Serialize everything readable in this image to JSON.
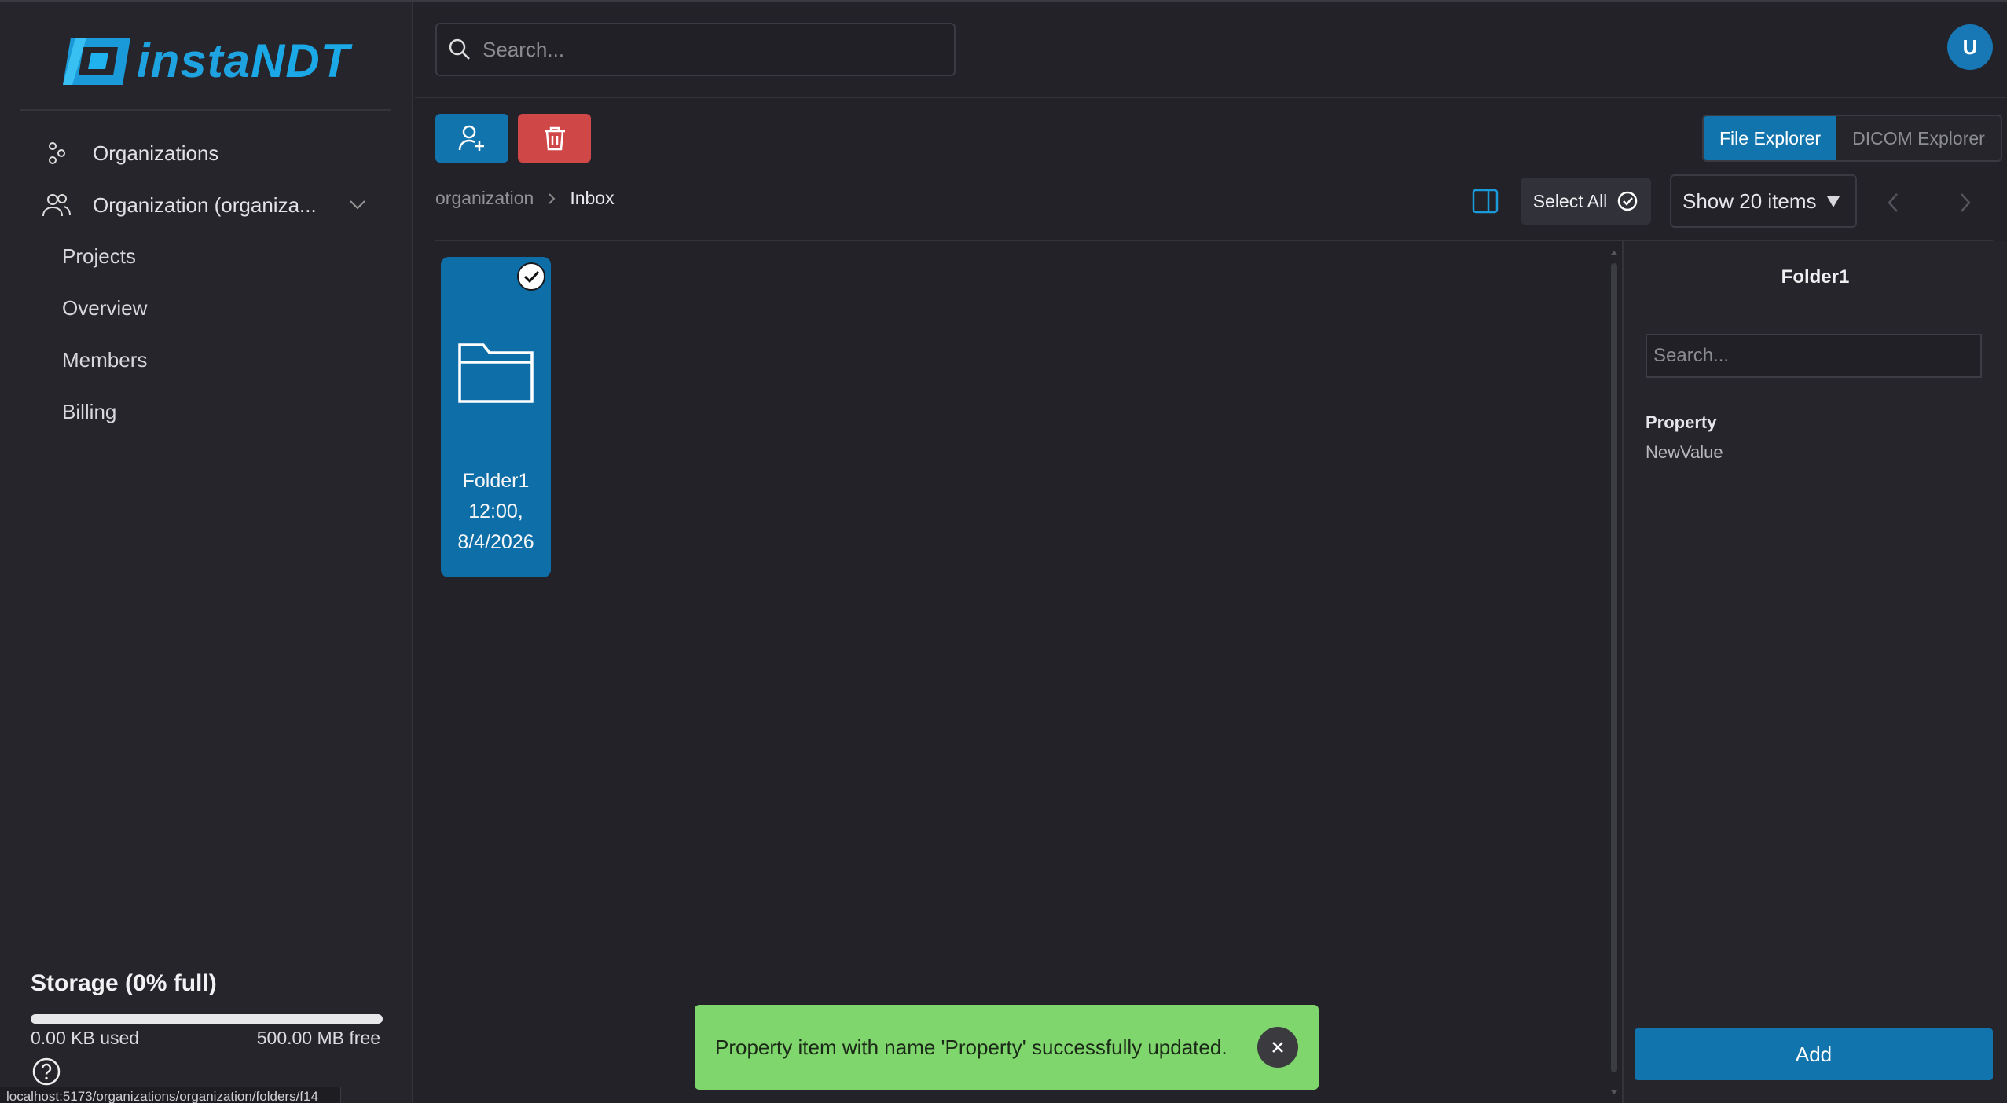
{
  "app": {
    "logo_text_a": "insta",
    "logo_text_b": "NDT",
    "brand_color": "#1ba8e6"
  },
  "sidebar": {
    "items": [
      {
        "label": "Organizations",
        "icon": "nodes-icon"
      },
      {
        "label": "Organization (organiza...",
        "icon": "users-icon"
      }
    ],
    "subitems": [
      {
        "label": "Projects"
      },
      {
        "label": "Overview"
      },
      {
        "label": "Members"
      },
      {
        "label": "Billing"
      }
    ],
    "storage": {
      "title": "Storage (0% full)",
      "used": "0.00 KB used",
      "free": "500.00 MB free",
      "fill_percent": 0
    },
    "status_url": "localhost:5173/organizations/organization/folders/f14"
  },
  "header": {
    "search_placeholder": "Search...",
    "avatar_initial": "U"
  },
  "toolbar": {
    "explorer_tabs": [
      {
        "label": "File Explorer",
        "active": true
      },
      {
        "label": "DICOM Explorer",
        "active": false
      }
    ],
    "select_all_label": "Select All",
    "show_items_label": "Show 20 items"
  },
  "breadcrumb": {
    "root": "organization",
    "current": "Inbox"
  },
  "files": [
    {
      "name": "Folder1",
      "time": "12:00,",
      "date": "8/4/2026",
      "selected": true
    }
  ],
  "right_panel": {
    "title": "Folder1",
    "search_placeholder": "Search...",
    "property_name": "Property",
    "property_value": "NewValue",
    "add_label": "Add"
  },
  "toast": {
    "message": "Property item with name 'Property' successfully updated.",
    "color": "#7fd66d"
  },
  "colors": {
    "primary": "#1274ad",
    "danger": "#d04747",
    "background": "#222228"
  }
}
